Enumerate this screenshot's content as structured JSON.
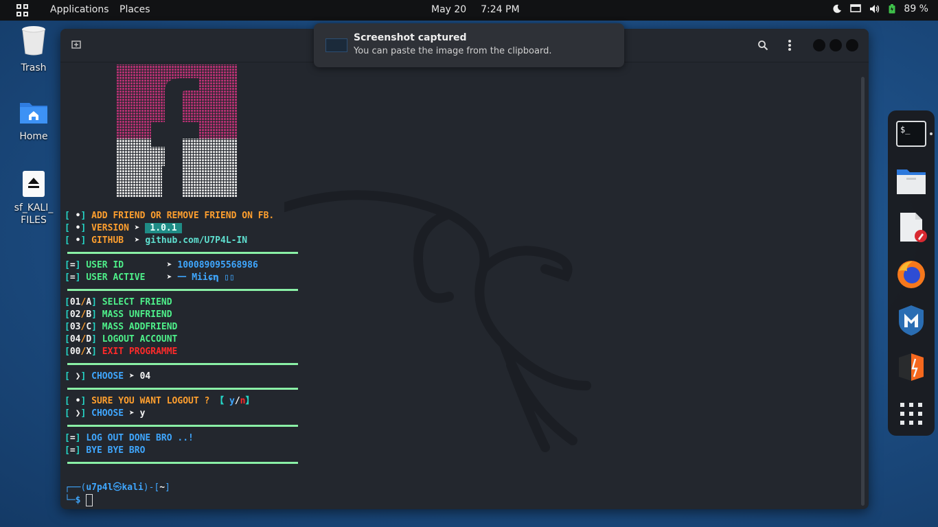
{
  "topbar": {
    "applications": "Applications",
    "places": "Places",
    "date": "May 20",
    "time": "7:24 PM",
    "battery": "89 %"
  },
  "desktop": {
    "icons": [
      {
        "label": "Trash",
        "icon": "trash-icon"
      },
      {
        "label": "Home",
        "icon": "home-folder-icon"
      },
      {
        "label": "sf_KALI_\nFILES",
        "icon": "eject-drive-icon"
      }
    ]
  },
  "notification": {
    "title": "Screenshot captured",
    "body": "You can paste the image from the clipboard."
  },
  "terminal": {
    "info": [
      {
        "tag": "•",
        "label": "ADD FRIEND OR REMOVE FRIEND ON FB.",
        "arrow": "",
        "value": ""
      },
      {
        "tag": "•",
        "label": "VERSION",
        "arrow": "➤",
        "value": "1.0.1"
      },
      {
        "tag": "•",
        "label": "GITHUB",
        "arrow": "➤",
        "value": "github.com/U7P4L-IN"
      }
    ],
    "user": [
      {
        "tag": "=",
        "label": "USER ID",
        "arrow": "➤",
        "value": "100089095568986"
      },
      {
        "tag": "=",
        "label": "USER ACTIVE",
        "arrow": "➤",
        "value": "一 Miiɕ𝛈 ▯▯"
      }
    ],
    "menu": [
      {
        "code": "01",
        "key": "A",
        "label": "SELECT FRIEND"
      },
      {
        "code": "02",
        "key": "B",
        "label": "MASS UNFRIEND"
      },
      {
        "code": "03",
        "key": "C",
        "label": "MASS ADDFRIEND"
      },
      {
        "code": "04",
        "key": "D",
        "label": "LOGOUT ACCOUNT"
      },
      {
        "code": "00",
        "key": "X",
        "label": "EXIT PROGRAMME"
      }
    ],
    "choose1": {
      "tag": "❯",
      "label": "CHOOSE",
      "arrow": "➤",
      "value": "04"
    },
    "confirm": {
      "tag": "•",
      "label": "SURE YOU WANT LOGOUT ?",
      "y": "y",
      "n": "n"
    },
    "choose2": {
      "tag": "❯",
      "label": "CHOOSE",
      "arrow": "➤",
      "value": "y"
    },
    "done": [
      {
        "tag": "=",
        "label": "LOG OUT DONE BRO ..!"
      },
      {
        "tag": "=",
        "label": "BYE BYE BRO"
      }
    ],
    "prompt": {
      "user": "u7p4l",
      "host": "kali",
      "dir": "~",
      "symbol": "$"
    }
  },
  "colors": {
    "accent_teal": "#25d6c7",
    "orange": "#ff9f2e",
    "green": "#4ef08a",
    "blue": "#3fa7ff",
    "red": "#ff2a2a",
    "logo_pink": "#b0306f"
  },
  "dock": {
    "apps": [
      "terminal-icon",
      "files-icon",
      "text-editor-icon",
      "firefox-icon",
      "metasploit-icon",
      "burpsuite-icon",
      "app-grid-icon"
    ]
  }
}
